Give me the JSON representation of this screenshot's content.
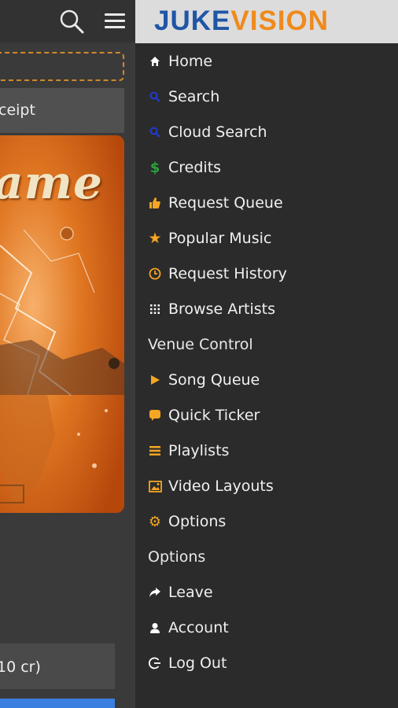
{
  "app": {
    "logo_part1": "JUKE",
    "logo_part2": "VISION"
  },
  "background": {
    "receipt_text": "ceipt",
    "album_title_fragment": "ame",
    "credits_text": "10 cr)"
  },
  "menu": [
    {
      "label": "Home",
      "icon": "home-icon"
    },
    {
      "label": "Search",
      "icon": "search-icon"
    },
    {
      "label": "Cloud Search",
      "icon": "search-icon"
    },
    {
      "label": "Credits",
      "icon": "dollar-icon"
    },
    {
      "label": "Request Queue",
      "icon": "thumbs-up-icon"
    },
    {
      "label": "Popular Music",
      "icon": "star-icon"
    },
    {
      "label": "Request History",
      "icon": "clock-icon"
    },
    {
      "label": "Browse Artists",
      "icon": "grid-icon"
    },
    {
      "label": "Venue Control",
      "icon": ""
    },
    {
      "label": "Song Queue",
      "icon": "play-icon"
    },
    {
      "label": "Quick Ticker",
      "icon": "chat-bubble-icon"
    },
    {
      "label": "Playlists",
      "icon": "list-icon"
    },
    {
      "label": "Video Layouts",
      "icon": "image-icon"
    },
    {
      "label": "Options",
      "icon": "gear-icon"
    },
    {
      "label": "Options",
      "icon": ""
    },
    {
      "label": "Leave",
      "icon": "share-arrow-icon"
    },
    {
      "label": "Account",
      "icon": "user-icon"
    },
    {
      "label": "Log Out",
      "icon": "logout-icon"
    }
  ],
  "colors": {
    "accent_orange": "#f5a623",
    "search_blue": "#1f3bd6",
    "credit_green": "#2aa33a",
    "logo_blue": "#1f55a6"
  }
}
